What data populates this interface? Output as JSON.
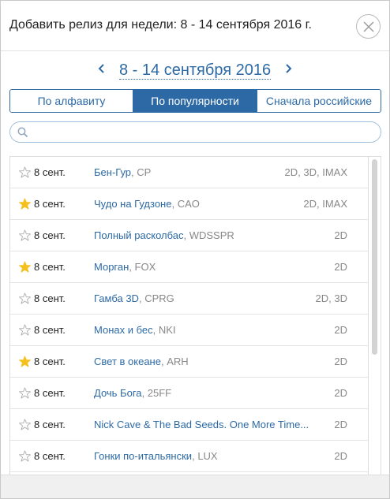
{
  "header": {
    "title": "Добавить релиз для недели: 8 - 14 сентября 2016 г."
  },
  "week_nav": {
    "label": "8 - 14 сентября 2016"
  },
  "tabs": [
    {
      "label": "По алфавиту",
      "active": false
    },
    {
      "label": "По популярности",
      "active": true
    },
    {
      "label": "Сначала российские",
      "active": false
    }
  ],
  "search": {
    "value": "",
    "placeholder": ""
  },
  "colors": {
    "accent": "#2d6aa5",
    "star_filled": "#f5bf1d",
    "star_empty": "#b0b0b0"
  },
  "movies": [
    {
      "starred": false,
      "date": "8 сент.",
      "title": "Бен-Гур",
      "distributor": "CP",
      "formats": "2D, 3D, IMAX"
    },
    {
      "starred": true,
      "date": "8 сент.",
      "title": "Чудо на Гудзоне",
      "distributor": "CAO",
      "formats": "2D, IMAX"
    },
    {
      "starred": false,
      "date": "8 сент.",
      "title": "Полный расколбас",
      "distributor": "WDSSPR",
      "formats": "2D"
    },
    {
      "starred": true,
      "date": "8 сент.",
      "title": "Морган",
      "distributor": "FOX",
      "formats": "2D"
    },
    {
      "starred": false,
      "date": "8 сент.",
      "title": "Гамба 3D",
      "distributor": "CPRG",
      "formats": "2D, 3D"
    },
    {
      "starred": false,
      "date": "8 сент.",
      "title": "Монах и бес",
      "distributor": "NKI",
      "formats": "2D"
    },
    {
      "starred": true,
      "date": "8 сент.",
      "title": "Свет в океане",
      "distributor": "ARH",
      "formats": "2D"
    },
    {
      "starred": false,
      "date": "8 сент.",
      "title": "Дочь Бога",
      "distributor": "25FF",
      "formats": "2D"
    },
    {
      "starred": false,
      "date": "8 сент.",
      "title": "Nick Cave & The Bad Seeds. One More Time...",
      "distributor": "",
      "formats": "2D"
    },
    {
      "starred": false,
      "date": "8 сент.",
      "title": "Гонки по-итальянски",
      "distributor": "LUX",
      "formats": "2D"
    }
  ]
}
